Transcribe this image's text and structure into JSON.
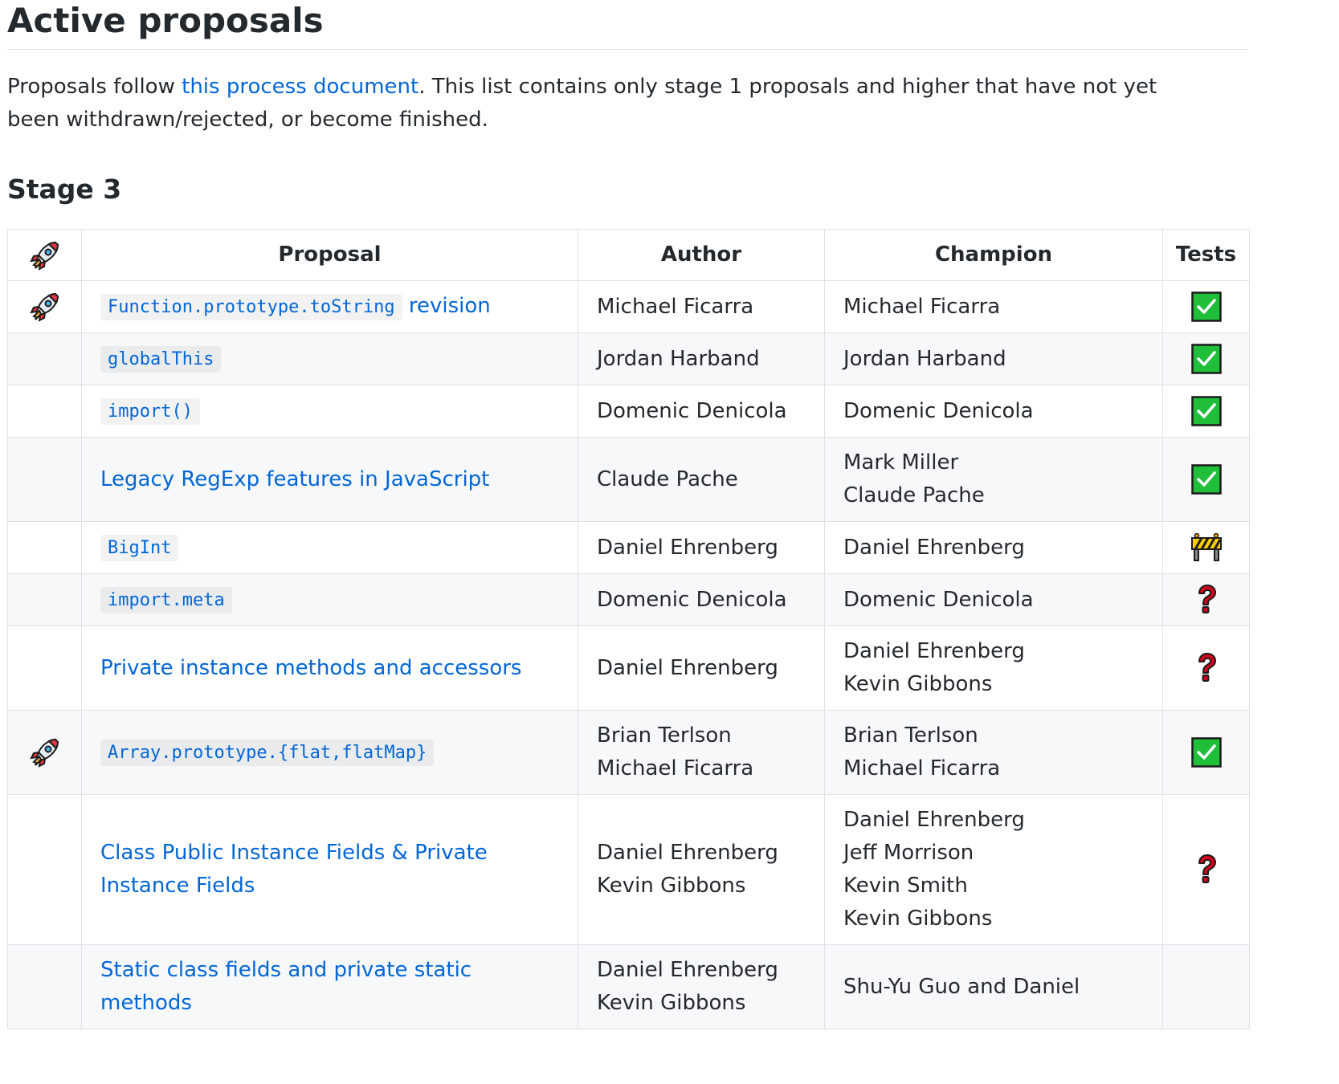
{
  "heading": "Active proposals",
  "intro": {
    "before": "Proposals follow ",
    "link": "this process document",
    "after": ". This list contains only stage 1 proposals and higher that have not yet been withdrawn/rejected, or become finished."
  },
  "stage_title": "Stage 3",
  "table": {
    "columns": [
      "Proposal",
      "Author",
      "Champion",
      "Tests"
    ],
    "header_icon": "rocket-icon",
    "rows": [
      {
        "rocket": true,
        "code": "Function.prototype.toString",
        "link": "revision",
        "authors": [
          "Michael Ficarra"
        ],
        "champions": [
          "Michael Ficarra"
        ],
        "tests": "check"
      },
      {
        "rocket": false,
        "code": "globalThis",
        "link": "",
        "authors": [
          "Jordan Harband"
        ],
        "champions": [
          "Jordan Harband"
        ],
        "tests": "check"
      },
      {
        "rocket": false,
        "code": "import()",
        "link": "",
        "authors": [
          "Domenic Denicola"
        ],
        "champions": [
          "Domenic Denicola"
        ],
        "tests": "check"
      },
      {
        "rocket": false,
        "code": "",
        "link": "Legacy RegExp features in JavaScript",
        "authors": [
          "Claude Pache"
        ],
        "champions": [
          "Mark Miller",
          "Claude Pache"
        ],
        "tests": "check"
      },
      {
        "rocket": false,
        "code": "BigInt",
        "link": "",
        "authors": [
          "Daniel Ehrenberg"
        ],
        "champions": [
          "Daniel Ehrenberg"
        ],
        "tests": "construction"
      },
      {
        "rocket": false,
        "code": "import.meta",
        "link": "",
        "authors": [
          "Domenic Denicola"
        ],
        "champions": [
          "Domenic Denicola"
        ],
        "tests": "question"
      },
      {
        "rocket": false,
        "code": "",
        "link": "Private instance methods and accessors",
        "authors": [
          "Daniel Ehrenberg"
        ],
        "champions": [
          "Daniel Ehrenberg",
          "Kevin Gibbons"
        ],
        "tests": "question"
      },
      {
        "rocket": true,
        "code": "Array.prototype.{flat,flatMap}",
        "link": "",
        "authors": [
          "Brian Terlson",
          "Michael Ficarra"
        ],
        "champions": [
          "Brian Terlson",
          "Michael Ficarra"
        ],
        "tests": "check"
      },
      {
        "rocket": false,
        "code": "",
        "link": "Class Public Instance Fields & Private Instance Fields",
        "authors": [
          "Daniel Ehrenberg",
          "Kevin Gibbons"
        ],
        "champions": [
          "Daniel Ehrenberg",
          "Jeff Morrison",
          "Kevin Smith",
          "Kevin Gibbons"
        ],
        "tests": "question"
      },
      {
        "rocket": false,
        "code": "",
        "link": "Static class fields and private static methods",
        "authors": [
          "Daniel Ehrenberg",
          "Kevin Gibbons"
        ],
        "champions": [
          "Shu-Yu Guo and Daniel"
        ],
        "tests": ""
      }
    ]
  },
  "colors": {
    "link": "#0366d6",
    "text": "#24292e",
    "check_green": "#1fbf3a",
    "question_red": "#d0021b",
    "border": "#dfe2e5",
    "stripe": "#f6f8fa"
  }
}
